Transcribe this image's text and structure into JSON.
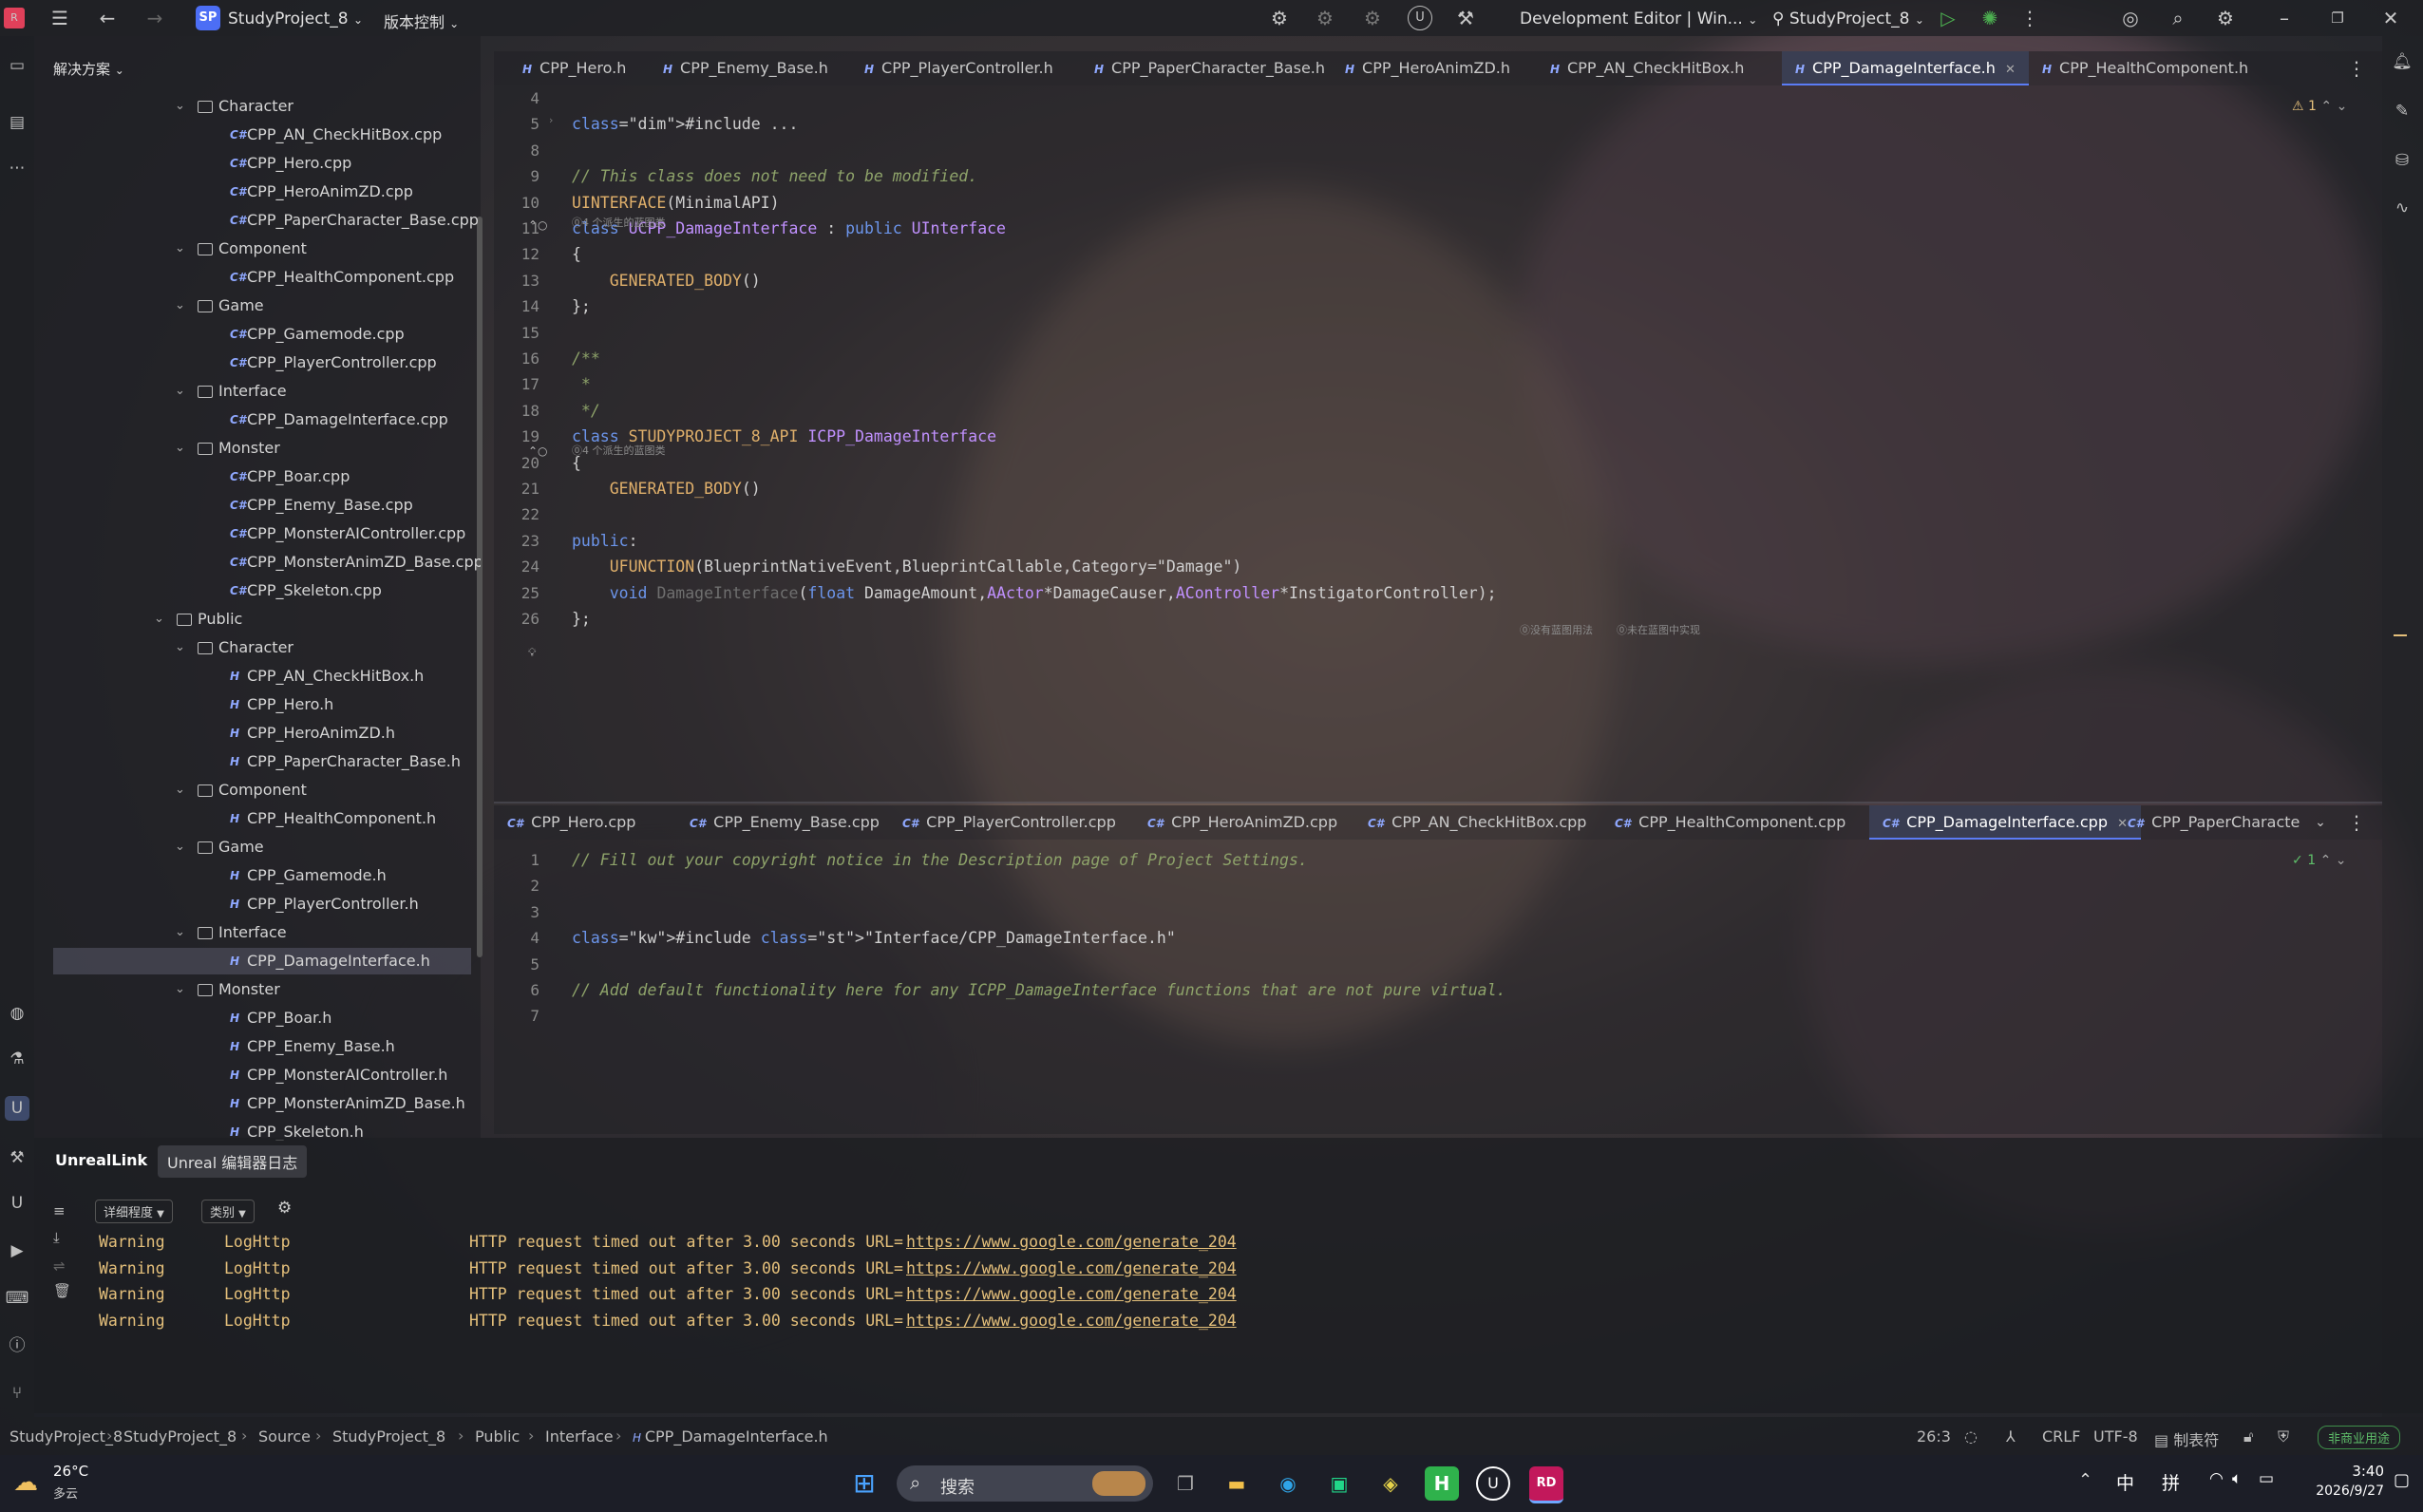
{
  "colors": {
    "accent": "#5b7cf5",
    "warning": "#e5c07b",
    "comment": "#8ea36a",
    "keyword": "#6c95eb",
    "type": "#c191ff",
    "macro": "#e0b06b"
  },
  "titlebar": {
    "project_badge": "SP",
    "project_name": "StudyProject_8",
    "vcs_label": "版本控制",
    "config_label": "Development Editor | Win...",
    "run_target": "StudyProject_8"
  },
  "explorer": {
    "title": "解决方案",
    "tree": [
      {
        "label": "Character",
        "type": "folder"
      },
      {
        "label": "CPP_AN_CheckHitBox.cpp",
        "type": "file"
      },
      {
        "label": "CPP_Hero.cpp",
        "type": "file"
      },
      {
        "label": "CPP_HeroAnimZD.cpp",
        "type": "file"
      },
      {
        "label": "CPP_PaperCharacter_Base.cpp",
        "type": "file"
      },
      {
        "label": "Component",
        "type": "folder"
      },
      {
        "label": "CPP_HealthComponent.cpp",
        "type": "file"
      },
      {
        "label": "Game",
        "type": "folder"
      },
      {
        "label": "CPP_Gamemode.cpp",
        "type": "file"
      },
      {
        "label": "CPP_PlayerController.cpp",
        "type": "file"
      },
      {
        "label": "Interface",
        "type": "folder"
      },
      {
        "label": "CPP_DamageInterface.cpp",
        "type": "file"
      },
      {
        "label": "Monster",
        "type": "folder"
      },
      {
        "label": "CPP_Boar.cpp",
        "type": "file"
      },
      {
        "label": "CPP_Enemy_Base.cpp",
        "type": "file"
      },
      {
        "label": "CPP_MonsterAIController.cpp",
        "type": "file"
      },
      {
        "label": "CPP_MonsterAnimZD_Base.cpp",
        "type": "file"
      },
      {
        "label": "CPP_Skeleton.cpp",
        "type": "file"
      },
      {
        "label": "Public",
        "type": "folder"
      },
      {
        "label": "Character",
        "type": "folder"
      },
      {
        "label": "CPP_AN_CheckHitBox.h",
        "type": "file"
      },
      {
        "label": "CPP_Hero.h",
        "type": "file"
      },
      {
        "label": "CPP_HeroAnimZD.h",
        "type": "file"
      },
      {
        "label": "CPP_PaperCharacter_Base.h",
        "type": "file"
      },
      {
        "label": "Component",
        "type": "folder"
      },
      {
        "label": "CPP_HealthComponent.h",
        "type": "file"
      },
      {
        "label": "Game",
        "type": "folder"
      },
      {
        "label": "CPP_Gamemode.h",
        "type": "file"
      },
      {
        "label": "CPP_PlayerController.h",
        "type": "file"
      },
      {
        "label": "Interface",
        "type": "folder"
      },
      {
        "label": "CPP_DamageInterface.h",
        "type": "file",
        "selected": true
      },
      {
        "label": "Monster",
        "type": "folder"
      },
      {
        "label": "CPP_Boar.h",
        "type": "file"
      },
      {
        "label": "CPP_Enemy_Base.h",
        "type": "file"
      },
      {
        "label": "CPP_MonsterAIController.h",
        "type": "file"
      },
      {
        "label": "CPP_MonsterAnimZD_Base.h",
        "type": "file"
      },
      {
        "label": "CPP_Skeleton.h",
        "type": "file"
      }
    ]
  },
  "top_tabs": [
    "CPP_Hero.h",
    "CPP_Enemy_Base.h",
    "CPP_PlayerController.h",
    "CPP_PaperCharacter_Base.h",
    "CPP_HeroAnimZD.h",
    "CPP_AN_CheckHitBox.h",
    "CPP_DamageInterface.h",
    "CPP_HealthComponent.h"
  ],
  "bottom_tabs": [
    "CPP_Hero.cpp",
    "CPP_Enemy_Base.cpp",
    "CPP_PlayerController.cpp",
    "CPP_HeroAnimZD.cpp",
    "CPP_AN_CheckHitBox.cpp",
    "CPP_HealthComponent.cpp",
    "CPP_DamageInterface.cpp",
    "CPP_PaperCharacte"
  ],
  "top_editor": {
    "inspection_count": "1",
    "lines": [
      {
        "n": "4",
        "code": ""
      },
      {
        "n": "5",
        "code": "#include ..."
      },
      {
        "n": "8",
        "code": ""
      },
      {
        "n": "9",
        "code": "// This class does not need to be modified."
      },
      {
        "n": "10",
        "code": "UINTERFACE(MinimalAPI)"
      },
      {
        "n": "11",
        "code": "class UCPP_DamageInterface : public UInterface"
      },
      {
        "n": "12",
        "code": "{"
      },
      {
        "n": "13",
        "code": "    GENERATED_BODY()"
      },
      {
        "n": "14",
        "code": "};"
      },
      {
        "n": "15",
        "code": ""
      },
      {
        "n": "16",
        "code": "/**"
      },
      {
        "n": "17",
        "code": " *"
      },
      {
        "n": "18",
        "code": " */"
      },
      {
        "n": "19",
        "code": "class STUDYPROJECT_8_API ICPP_DamageInterface"
      },
      {
        "n": "20",
        "code": "{"
      },
      {
        "n": "21",
        "code": "    GENERATED_BODY()"
      },
      {
        "n": "22",
        "code": ""
      },
      {
        "n": "23",
        "code": "public:"
      },
      {
        "n": "24",
        "code": "    UFUNCTION(BlueprintNativeEvent,BlueprintCallable,Category=\"Damage\")"
      },
      {
        "n": "25",
        "code": "    void DamageInterface(float DamageAmount,AActor*DamageCauser,AController*InstigatorController);"
      },
      {
        "n": "26",
        "code": "};"
      }
    ],
    "hint_derived_1": "4 个派生的蓝图类",
    "hint_derived_2": "4 个派生的蓝图类",
    "hint_no_bp_usage": "没有蓝图用法",
    "hint_not_impl": "未在蓝图中实现"
  },
  "bottom_editor": {
    "inspection_count": "1",
    "lines": [
      {
        "n": "1",
        "code": "// Fill out your copyright notice in the Description page of Project Settings."
      },
      {
        "n": "2",
        "code": ""
      },
      {
        "n": "3",
        "code": ""
      },
      {
        "n": "4",
        "code": "#include \"Interface/CPP_DamageInterface.h\""
      },
      {
        "n": "5",
        "code": ""
      },
      {
        "n": "6",
        "code": "// Add default functionality here for any ICPP_DamageInterface functions that are not pure virtual."
      },
      {
        "n": "7",
        "code": ""
      }
    ]
  },
  "panel": {
    "tabs": [
      "UnrealLink",
      "Unreal 编辑器日志"
    ],
    "filter_verbosity": "详细程度",
    "filter_category": "类别",
    "logs": [
      {
        "level": "Warning",
        "category": "LogHttp",
        "message": "HTTP request timed out after 3.00 seconds URL=",
        "url": "https://www.google.com/generate_204"
      },
      {
        "level": "Warning",
        "category": "LogHttp",
        "message": "HTTP request timed out after 3.00 seconds URL=",
        "url": "https://www.google.com/generate_204"
      },
      {
        "level": "Warning",
        "category": "LogHttp",
        "message": "HTTP request timed out after 3.00 seconds URL=",
        "url": "https://www.google.com/generate_204"
      },
      {
        "level": "Warning",
        "category": "LogHttp",
        "message": "HTTP request timed out after 3.00 seconds URL=",
        "url": "https://www.google.com/generate_204"
      }
    ]
  },
  "statusbar": {
    "breadcrumb": [
      "StudyProject_8",
      "StudyProject_8",
      "Source",
      "StudyProject_8",
      "Public",
      "Interface",
      "CPP_DamageInterface.h"
    ],
    "cursor": "26:3",
    "line_ending": "CRLF",
    "encoding": "UTF-8",
    "tab_setting": "制表符",
    "license": "非商业用途"
  },
  "taskbar": {
    "weather_temp": "26°C",
    "weather_desc": "多云",
    "search_placeholder": "搜索",
    "ime_lang": "中",
    "ime_mode": "拼",
    "time": "3:40",
    "date": "2026/9/27"
  }
}
